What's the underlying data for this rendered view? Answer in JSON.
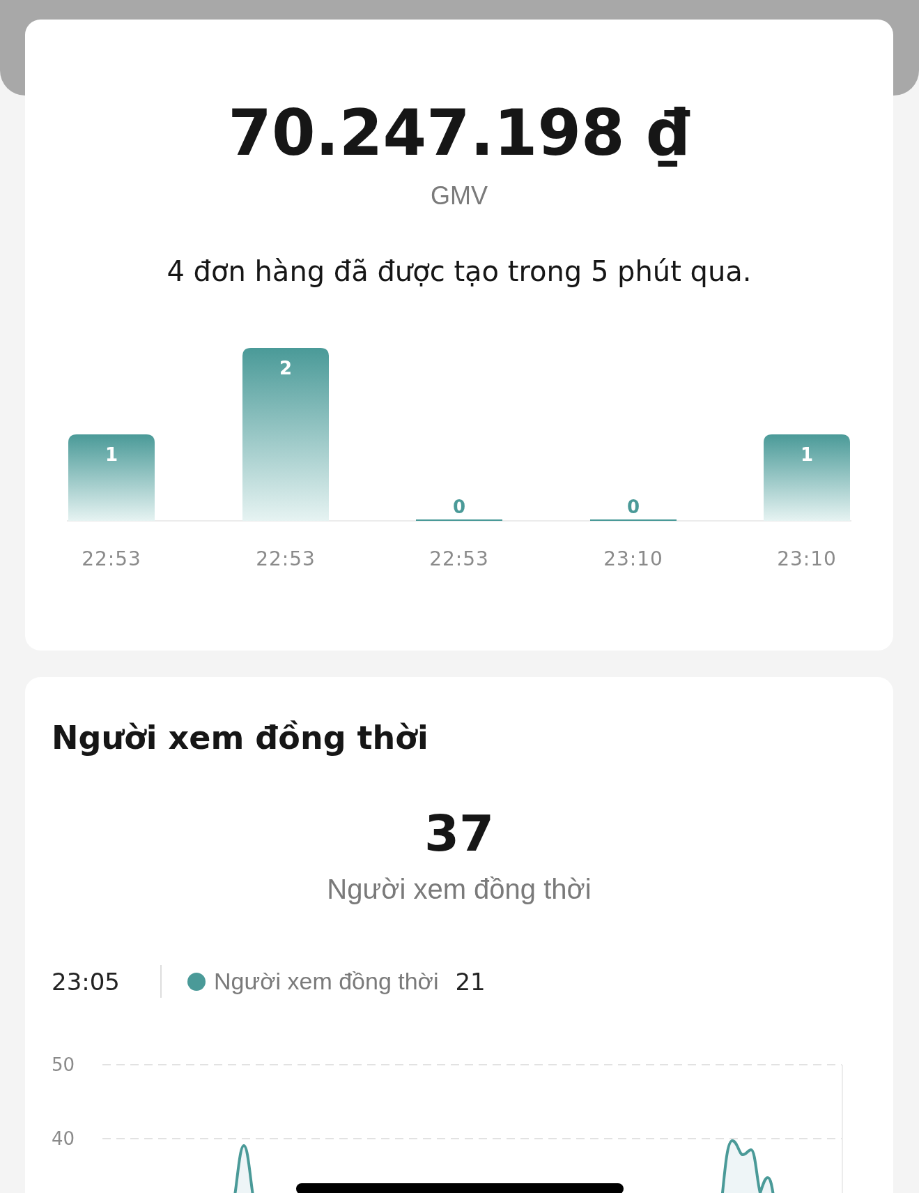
{
  "gmv_card": {
    "amount": "70.247.198 ₫",
    "amount_label": "GMV",
    "summary": "4 đơn hàng đã được tạo trong 5 phút qua.",
    "chart_data": {
      "type": "bar",
      "categories": [
        "22:53",
        "22:53",
        "22:53",
        "23:10",
        "23:10"
      ],
      "values": [
        1,
        2,
        0,
        0,
        1
      ],
      "data_labels": true
    }
  },
  "viewers_card": {
    "title": "Người xem đồng thời",
    "count": "37",
    "count_label": "Người xem đồng thời",
    "tooltip": {
      "time": "23:05",
      "series_name": "Người xem đồng thời",
      "value": "21",
      "color": "#4a9a98"
    },
    "y_ticks": [
      "50",
      "40"
    ]
  }
}
